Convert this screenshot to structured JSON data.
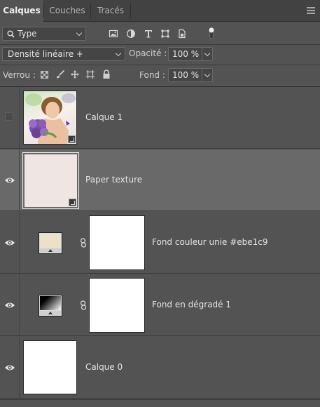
{
  "tabs": [
    {
      "label": "Calques",
      "active": true
    },
    {
      "label": "Couches",
      "active": false
    },
    {
      "label": "Tracés",
      "active": false
    }
  ],
  "filter": {
    "kind_value": "Type",
    "icons": [
      "image-filter-icon",
      "adjustment-filter-icon",
      "type-filter-icon",
      "shape-filter-icon",
      "smart-object-filter-icon"
    ]
  },
  "blend": {
    "mode": "Densité linéaire +",
    "opacity_label": "Opacité :",
    "opacity_value": "100 %"
  },
  "lock": {
    "label": "Verrou :",
    "icons": [
      "lock-transparent-pixels-icon",
      "lock-image-pixels-icon",
      "lock-position-icon",
      "lock-artboard-icon",
      "lock-all-icon"
    ],
    "fill_label": "Fond :",
    "fill_value": "100 %"
  },
  "layers": [
    {
      "name": "Calque 1",
      "visible": false,
      "selected": false,
      "type": "smart-object"
    },
    {
      "name": "Paper texture",
      "visible": true,
      "selected": true,
      "type": "smart-object",
      "color": "#efe6e3"
    },
    {
      "name": "Fond couleur unie #ebe1c9",
      "visible": true,
      "selected": false,
      "type": "solid-fill",
      "color": "#ebe1c9"
    },
    {
      "name": "Fond en dégradé 1",
      "visible": true,
      "selected": false,
      "type": "gradient-fill"
    },
    {
      "name": "Calque 0",
      "visible": true,
      "selected": false,
      "type": "pixel",
      "color": "#ffffff"
    }
  ],
  "colors": {
    "panel_bg": "#535353",
    "selected_row": "#696969",
    "tabbar_bg": "#424242"
  }
}
